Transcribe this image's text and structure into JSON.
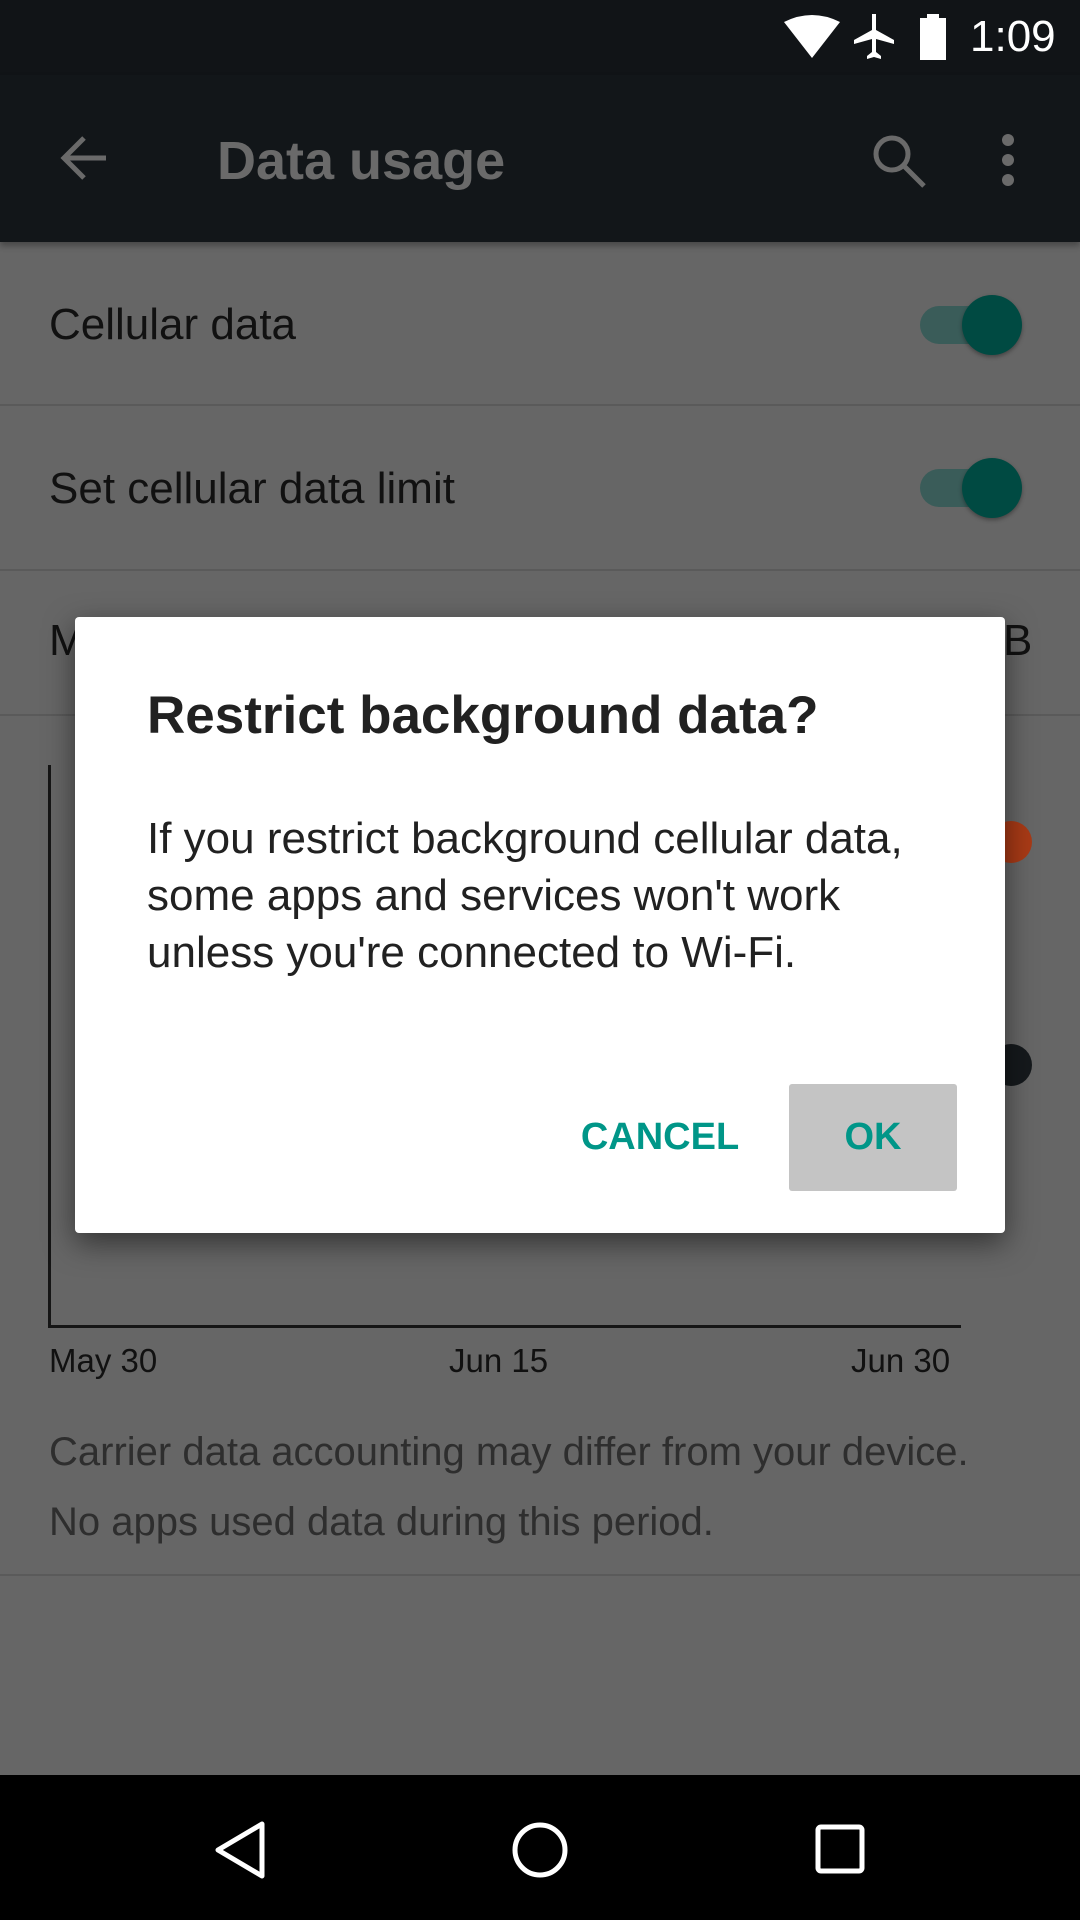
{
  "status_bar": {
    "time": "1:09",
    "icons": [
      "wifi-icon",
      "airplane-icon",
      "battery-icon"
    ]
  },
  "toolbar": {
    "title": "Data usage",
    "icons": [
      "back-arrow-icon",
      "search-icon",
      "more-vert-icon"
    ]
  },
  "settings": {
    "rows": [
      {
        "label": "Cellular data",
        "toggle": true
      },
      {
        "label": "Set cellular data limit",
        "toggle": true
      }
    ],
    "partial_row": {
      "left": "M",
      "right": "B"
    }
  },
  "chart": {
    "x_labels": [
      "May 30",
      "Jun 15",
      "Jun 30"
    ],
    "colors": {
      "limit": "#e64a19",
      "warning": "#263238"
    }
  },
  "footnotes": [
    "Carrier data accounting may differ from your device.",
    "No apps used data during this period."
  ],
  "dialog": {
    "title": "Restrict background data?",
    "body": "If you restrict background cellular data, some apps and services won't work unless you're connected to Wi-Fi.",
    "cancel": "CANCEL",
    "ok": "OK"
  },
  "colors": {
    "accent": "#009688",
    "toolbar": "#263238"
  },
  "nav": {
    "icons": [
      "back-icon",
      "home-icon",
      "recents-icon"
    ]
  }
}
